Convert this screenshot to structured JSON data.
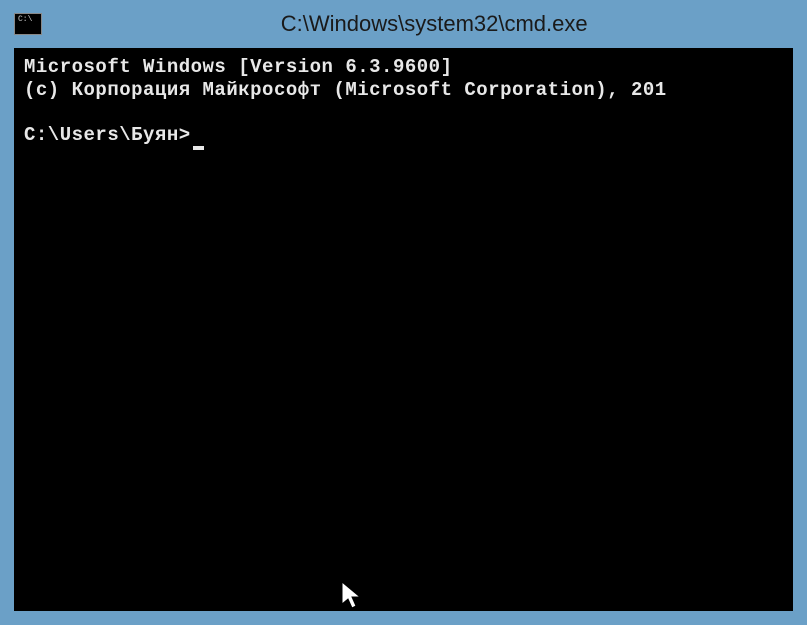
{
  "titlebar": {
    "icon_label": "C:\\",
    "title": "C:\\Windows\\system32\\cmd.exe"
  },
  "terminal": {
    "line1": "Microsoft Windows [Version 6.3.9600]",
    "line2": "(c) Корпорация Майкрософт (Microsoft Corporation), 201",
    "prompt": "C:\\Users\\Буян>"
  }
}
